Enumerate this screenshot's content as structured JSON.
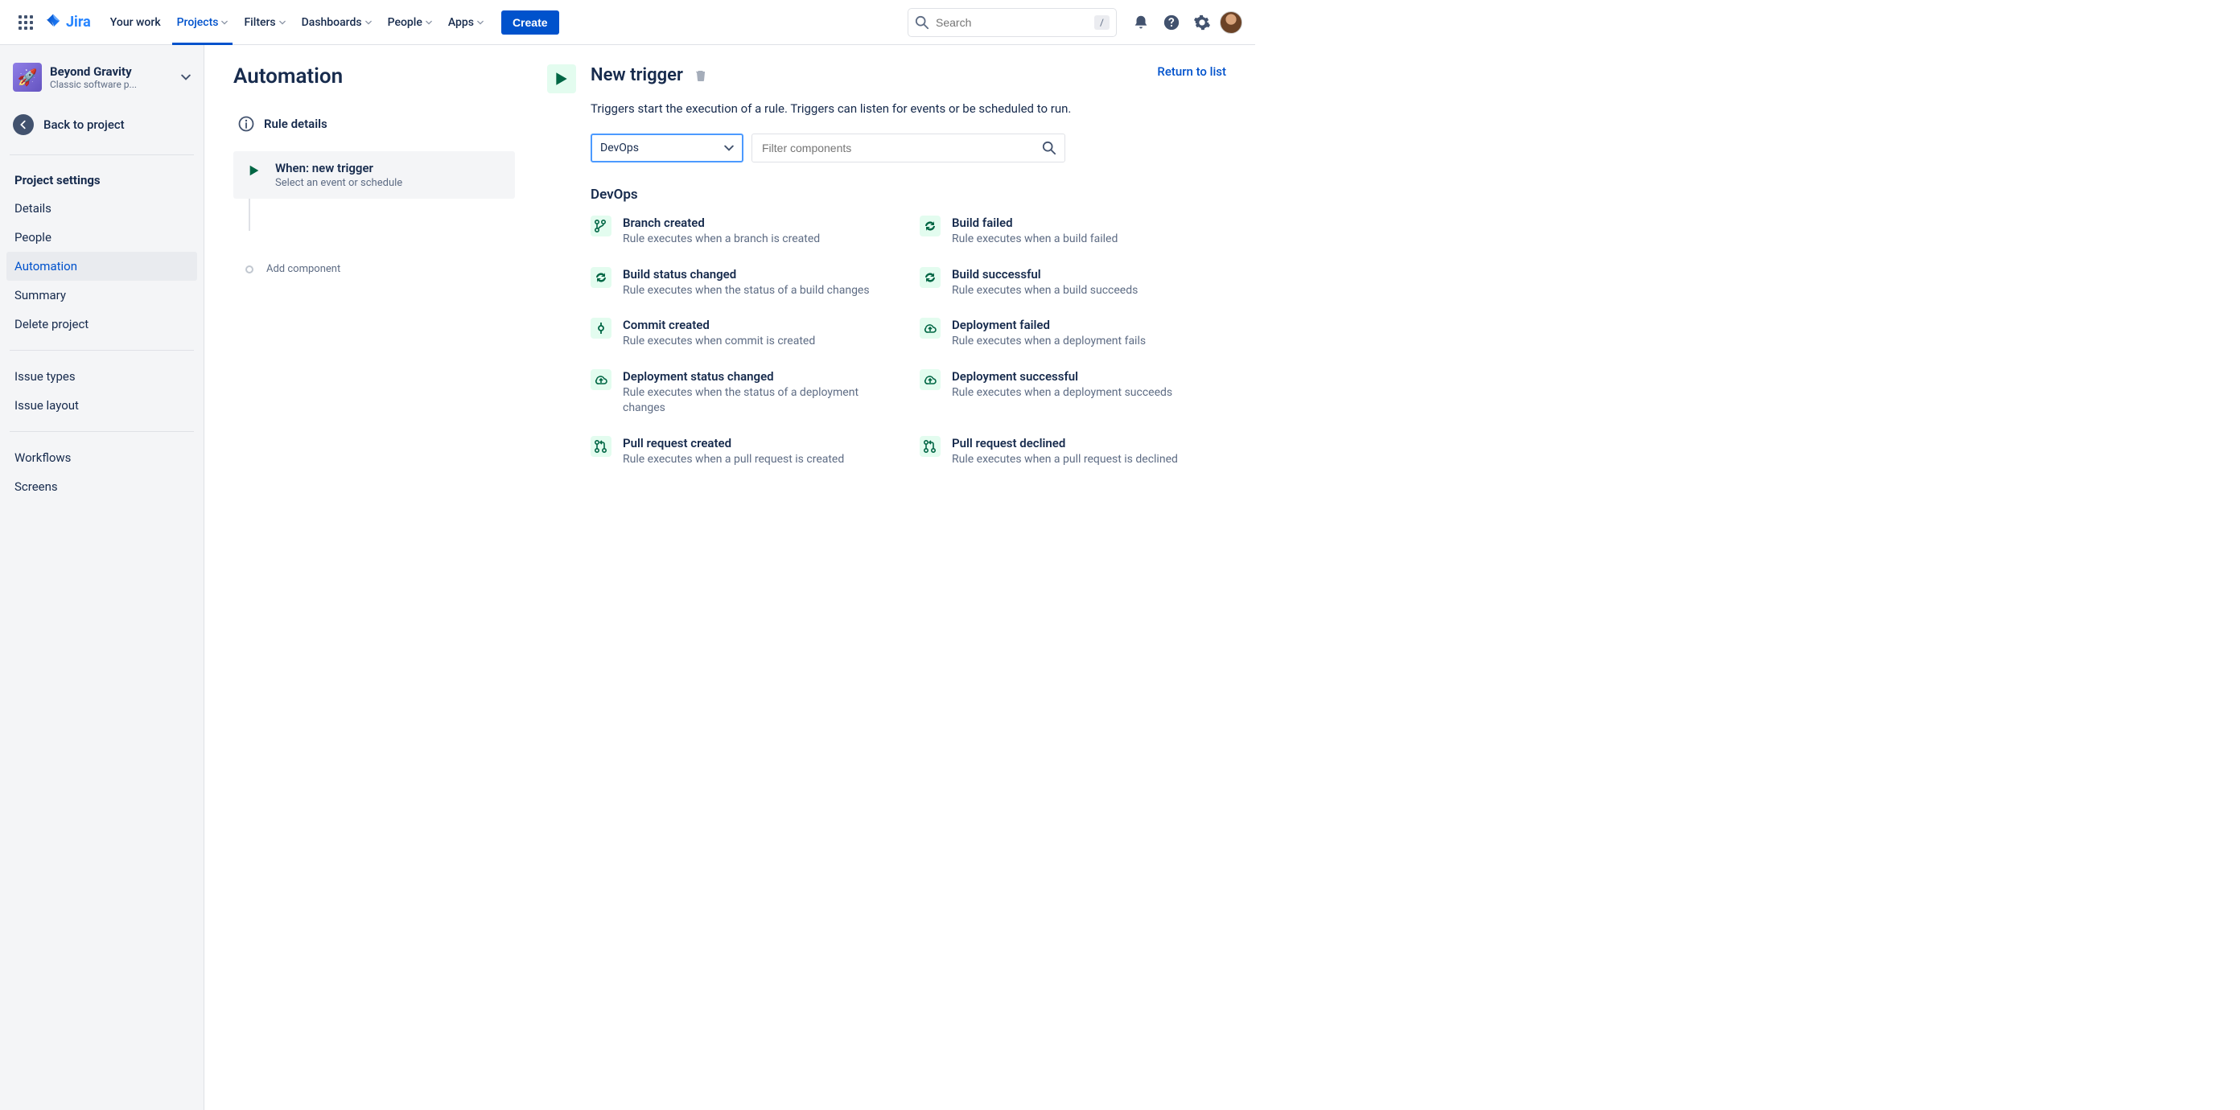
{
  "header": {
    "product": "Jira",
    "nav": [
      "Your work",
      "Projects",
      "Filters",
      "Dashboards",
      "People",
      "Apps"
    ],
    "active_nav_index": 1,
    "create": "Create",
    "search_placeholder": "Search",
    "shortcut": "/"
  },
  "sidebar": {
    "project_name": "Beyond Gravity",
    "project_type": "Classic software p...",
    "back": "Back to project",
    "section1_heading": "Project settings",
    "section1": [
      "Details",
      "People",
      "Automation",
      "Summary",
      "Delete project"
    ],
    "section1_active_index": 2,
    "section2": [
      "Issue types",
      "Issue layout"
    ],
    "section3": [
      "Workflows",
      "Screens"
    ]
  },
  "page": {
    "title": "Automation",
    "return": "Return to list",
    "rule_details": "Rule details",
    "step_title": "When: new trigger",
    "step_sub": "Select an event or schedule",
    "add_component": "Add component"
  },
  "trigger": {
    "title": "New trigger",
    "description": "Triggers start the execution of a rule. Triggers can listen for events or be scheduled to run.",
    "category_select": "DevOps",
    "filter_placeholder": "Filter components",
    "category_heading": "DevOps",
    "items": [
      {
        "icon": "branch",
        "title": "Branch created",
        "desc": "Rule executes when a branch is created"
      },
      {
        "icon": "cycle",
        "title": "Build failed",
        "desc": "Rule executes when a build failed"
      },
      {
        "icon": "cycle",
        "title": "Build status changed",
        "desc": "Rule executes when the status of a build changes"
      },
      {
        "icon": "cycle",
        "title": "Build successful",
        "desc": "Rule executes when a build succeeds"
      },
      {
        "icon": "commit",
        "title": "Commit created",
        "desc": "Rule executes when commit is created"
      },
      {
        "icon": "cloud",
        "title": "Deployment failed",
        "desc": "Rule executes when a deployment fails"
      },
      {
        "icon": "cloud",
        "title": "Deployment status changed",
        "desc": "Rule executes when the status of a deployment changes"
      },
      {
        "icon": "cloud",
        "title": "Deployment successful",
        "desc": "Rule executes when a deployment succeeds"
      },
      {
        "icon": "pr",
        "title": "Pull request created",
        "desc": "Rule executes when a pull request is created"
      },
      {
        "icon": "pr",
        "title": "Pull request declined",
        "desc": "Rule executes when a pull request is declined"
      }
    ]
  }
}
